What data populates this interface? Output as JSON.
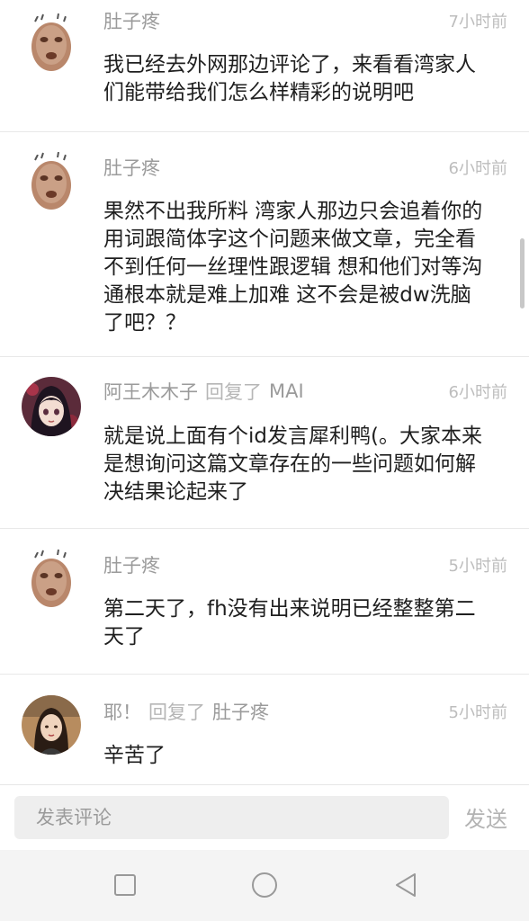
{
  "comments": [
    {
      "user": "肚子疼",
      "reply_label": "",
      "reply_target": "",
      "time": "7小时前",
      "lines": [
        "我已经去外网那边评论了，来看看湾家人",
        "们能带给我们怎么样精彩的说明吧"
      ]
    },
    {
      "user": "肚子疼",
      "reply_label": "",
      "reply_target": "",
      "time": "6小时前",
      "lines": [
        "果然不出我所料 湾家人那边只会追着你的",
        "用词跟简体字这个问题来做文章，完全看",
        "不到任何一丝理性跟逻辑 想和他们对等沟",
        "通根本就是难上加难 这不会是被dw洗脑",
        "了吧？？"
      ]
    },
    {
      "user": "阿王木木子",
      "reply_label": "回复了",
      "reply_target": "MAI",
      "time": "6小时前",
      "lines": [
        "就是说上面有个id发言犀利鸭(。大家本来",
        "是想询问这篇文章存在的一些问题如何解",
        "决结果论起来了"
      ]
    },
    {
      "user": "肚子疼",
      "reply_label": "",
      "reply_target": "",
      "time": "5小时前",
      "lines": [
        "第二天了，fh没有出来说明已经整整第二",
        "天了"
      ]
    },
    {
      "user": "耶！",
      "reply_label": "回复了",
      "reply_target": "肚子疼",
      "time": "5小时前",
      "lines": [
        "辛苦了"
      ]
    }
  ],
  "input": {
    "placeholder": "发表评论",
    "send_label": "发送"
  },
  "nav": {
    "buttons": [
      "square-recents-icon",
      "circle-home-icon",
      "triangle-back-icon"
    ]
  },
  "colors": {
    "text": "#1f1f1f",
    "meta": "#9b9b9b",
    "divider": "#e8e8e8",
    "input_bg": "#eeeeee",
    "nav_bg": "#f4f4f4"
  }
}
